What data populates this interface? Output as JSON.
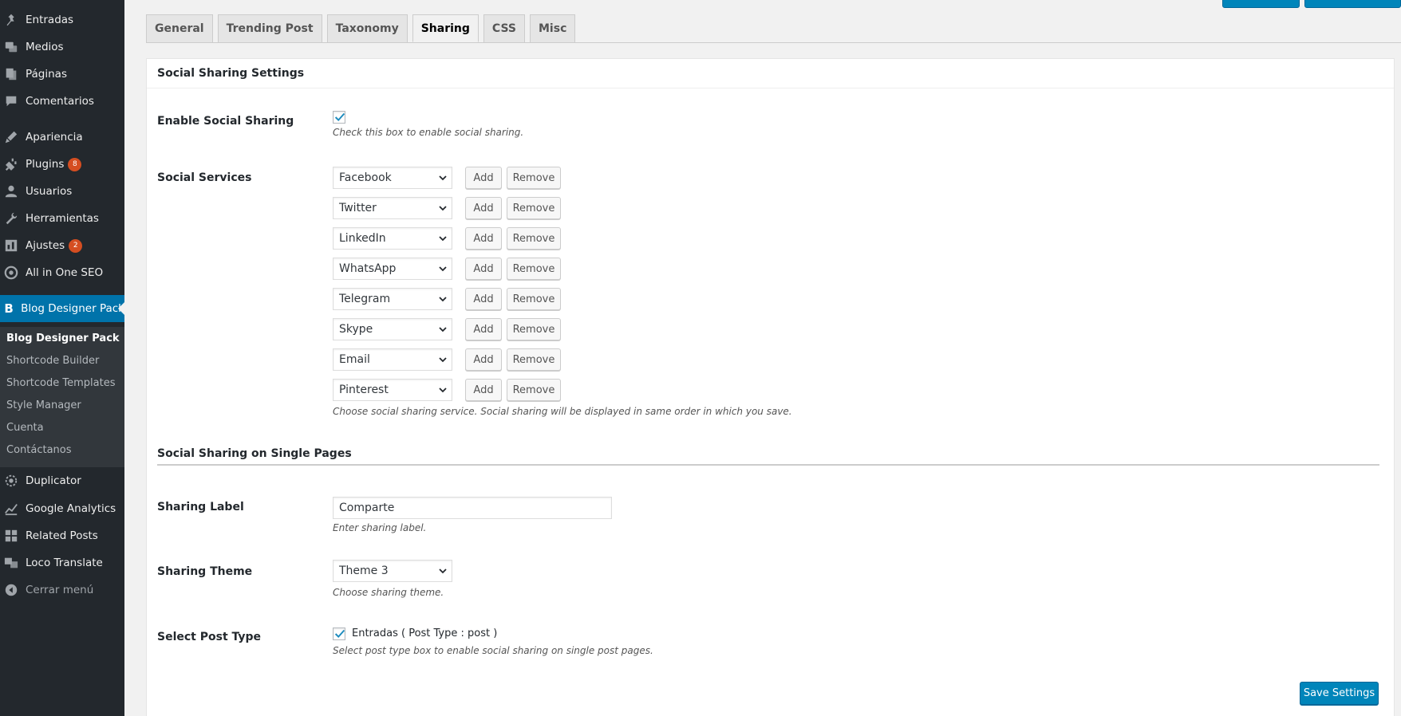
{
  "sidebar": {
    "menu": [
      {
        "label": "Entradas",
        "icon": "pushpin-icon"
      },
      {
        "label": "Medios",
        "icon": "media-icon"
      },
      {
        "label": "Páginas",
        "icon": "pages-icon"
      },
      {
        "label": "Comentarios",
        "icon": "comments-icon"
      },
      {
        "label": "Apariencia",
        "icon": "appearance-icon"
      },
      {
        "label": "Plugins",
        "icon": "plugins-icon",
        "badge": "8"
      },
      {
        "label": "Usuarios",
        "icon": "users-icon"
      },
      {
        "label": "Herramientas",
        "icon": "tools-icon"
      },
      {
        "label": "Ajustes",
        "icon": "settings-icon",
        "badge": "2"
      },
      {
        "label": "All in One SEO",
        "icon": "seo-icon"
      },
      {
        "label": "Blog Designer Pack",
        "icon": "blog-designer-icon",
        "icon_glyph": "B"
      },
      {
        "label": "Duplicator",
        "icon": "duplicator-icon"
      },
      {
        "label": "Google Analytics",
        "icon": "analytics-icon"
      },
      {
        "label": "Related Posts",
        "icon": "related-posts-icon"
      },
      {
        "label": "Loco Translate",
        "icon": "translate-icon"
      },
      {
        "label": "Cerrar menú",
        "icon": "collapse-menu-icon"
      }
    ],
    "submenu": [
      {
        "label": "Blog Designer Pack"
      },
      {
        "label": "Shortcode Builder"
      },
      {
        "label": "Shortcode Templates"
      },
      {
        "label": "Style Manager"
      },
      {
        "label": "Cuenta"
      },
      {
        "label": "Contáctanos"
      }
    ]
  },
  "tabs": [
    "General",
    "Trending Post",
    "Taxonomy",
    "Sharing",
    "CSS",
    "Misc"
  ],
  "active_tab": "Sharing",
  "panel": {
    "title": "Social Sharing Settings",
    "enable": {
      "label": "Enable Social Sharing",
      "checked": true,
      "description": "Check this box to enable social sharing."
    },
    "services": {
      "label": "Social Services",
      "items": [
        "Facebook",
        "Twitter",
        "LinkedIn",
        "WhatsApp",
        "Telegram",
        "Skype",
        "Email",
        "Pinterest"
      ],
      "add_label": "Add",
      "remove_label": "Remove",
      "description": "Choose social sharing service. Social sharing will be displayed in same order in which you save."
    },
    "single": {
      "title": "Social Sharing on Single Pages",
      "sharing_label": {
        "label": "Sharing Label",
        "value": "Comparte",
        "description": "Enter sharing label."
      },
      "sharing_theme": {
        "label": "Sharing Theme",
        "value": "Theme 3",
        "description": "Choose sharing theme."
      },
      "post_type": {
        "label": "Select Post Type",
        "option_label": "Entradas ( Post Type : post )",
        "checked": true,
        "description": "Select post type box to enable social sharing on single post pages."
      }
    },
    "save_label": "Save Settings"
  },
  "colors": {
    "sidebar_bg": "#23282d",
    "submenu_bg": "#32373c",
    "accent": "#0073aa",
    "primary_button": "#0085ba",
    "badge": "#d54e21",
    "check": "#1e8cbe"
  }
}
